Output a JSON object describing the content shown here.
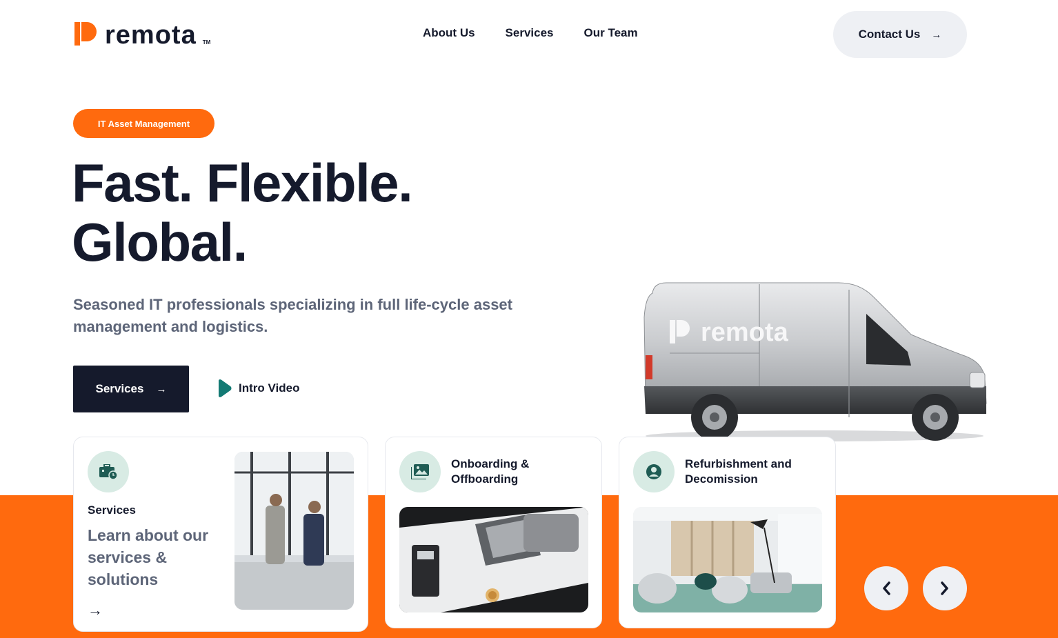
{
  "header": {
    "logo_text": "remota",
    "logo_tm": "TM",
    "nav": [
      "About Us",
      "Services",
      "Our Team"
    ],
    "contact_label": "Contact Us",
    "contact_arrow": "→"
  },
  "hero": {
    "badge": "IT Asset Management",
    "headline_line1": "Fast. Flexible.",
    "headline_line2": "Global.",
    "subtext": "Seasoned IT professionals specializing in full life-cycle asset management and logistics.",
    "primary_button": "Services",
    "primary_arrow": "→",
    "video_button": "Intro Video",
    "van_brand": "remota"
  },
  "cards": [
    {
      "title": "Services",
      "description": "Learn about our services & solutions",
      "link_arrow": "→",
      "icon": "briefcase-clock-icon"
    },
    {
      "title": "Onboarding & Offboarding",
      "icon": "photo-gallery-icon"
    },
    {
      "title": "Refurbishment and Decomission",
      "icon": "user-circle-icon"
    }
  ],
  "carousel": {
    "prev": "‹",
    "next": "›"
  },
  "colors": {
    "accent": "#ff6a0e",
    "dark": "#151a2c",
    "muted": "#5d6578",
    "mint": "#d8ebe4",
    "light": "#eef0f4"
  }
}
